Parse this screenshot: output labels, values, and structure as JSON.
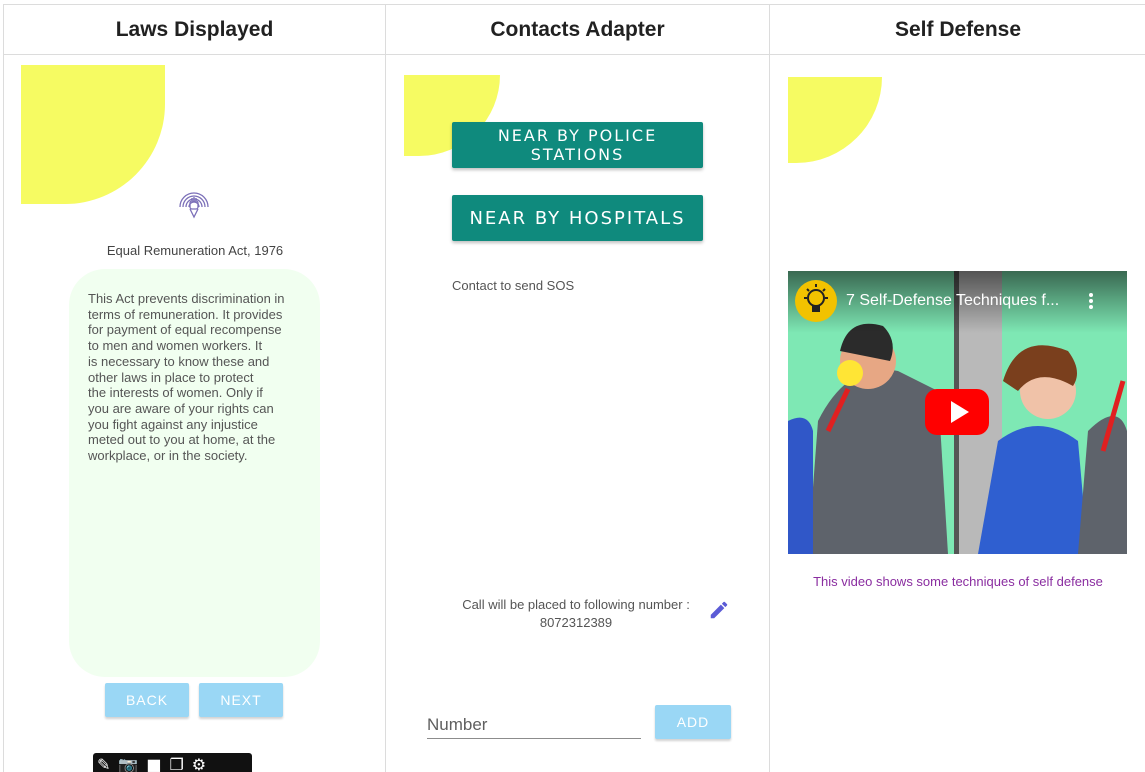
{
  "columns": {
    "laws": {
      "header": "Laws Displayed"
    },
    "contacts": {
      "header": "Contacts Adapter"
    },
    "self_defense": {
      "header": "Self Defense"
    }
  },
  "laws": {
    "act_title": "Equal Remuneration Act, 1976",
    "act_text": "This Act prevents discrimination in\nterms of remuneration. It provides\nfor payment of equal recompense\nto men and women workers. It\nis necessary to know these and\nother laws in place to protect\nthe interests of women. Only if\nyou are aware of your rights can\nyou fight against any injustice\nmeted out to you at home, at the\nworkplace, or in the society.",
    "back_label": "BACK",
    "next_label": "NEXT",
    "logo_icon": "raised-fist-signal-icon",
    "accent_color": "#f6fb62",
    "card_color": "#f1fff0",
    "button_color": "#9ad7f5"
  },
  "emulator_toolbar": {
    "icons": [
      "pin-icon",
      "camera-icon",
      "video-icon",
      "copy-icon",
      "gear-icon"
    ]
  },
  "contacts": {
    "police_label": "NEAR BY POLICE STATIONS",
    "hospitals_label": "NEAR BY HOSPITALS",
    "sos_label": "Contact to send SOS",
    "call_label": "Call will be placed to following number :",
    "call_number": "8072312389",
    "number_placeholder": "Number",
    "add_label": "ADD",
    "teal_color": "#0f8a7d"
  },
  "self_defense": {
    "video_title": "7 Self-Defense Techniques f...",
    "caption": "This video shows some techniques of self defense",
    "caption_color": "#8a2da0"
  }
}
